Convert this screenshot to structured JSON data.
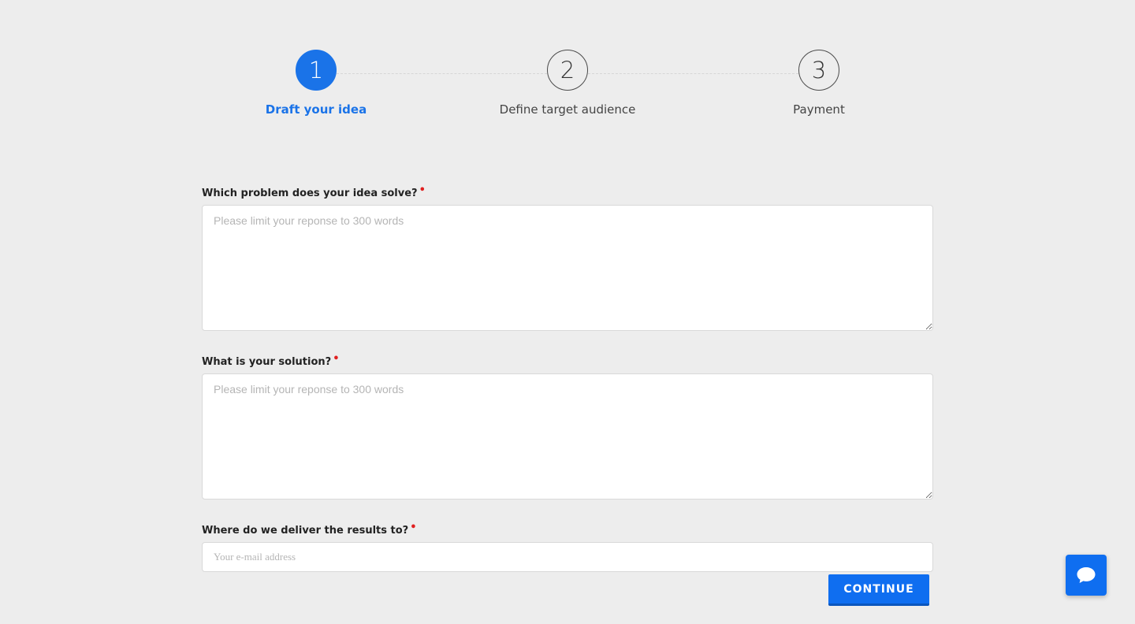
{
  "stepper": {
    "steps": [
      {
        "number": "1",
        "label": "Draft your idea",
        "active": true
      },
      {
        "number": "2",
        "label": "Define target audience",
        "active": false
      },
      {
        "number": "3",
        "label": "Payment",
        "active": false
      }
    ]
  },
  "form": {
    "problem": {
      "label": "Which problem does your idea solve?",
      "required_mark": "•",
      "placeholder": "Please limit your reponse to 300 words",
      "value": ""
    },
    "solution": {
      "label": "What is your solution?",
      "required_mark": "•",
      "placeholder": "Please limit your reponse to 300 words",
      "value": ""
    },
    "delivery": {
      "label": "Where do we deliver the results to?",
      "required_mark": "•",
      "placeholder": "Your e-mail address",
      "value": ""
    },
    "continue_label": "CONTINUE"
  },
  "chat_widget": {
    "icon": "chat-bubble-icon"
  },
  "colors": {
    "accent": "#1a73e8",
    "button": "#0f6ef0",
    "required": "#e02020",
    "background": "#ededed"
  }
}
